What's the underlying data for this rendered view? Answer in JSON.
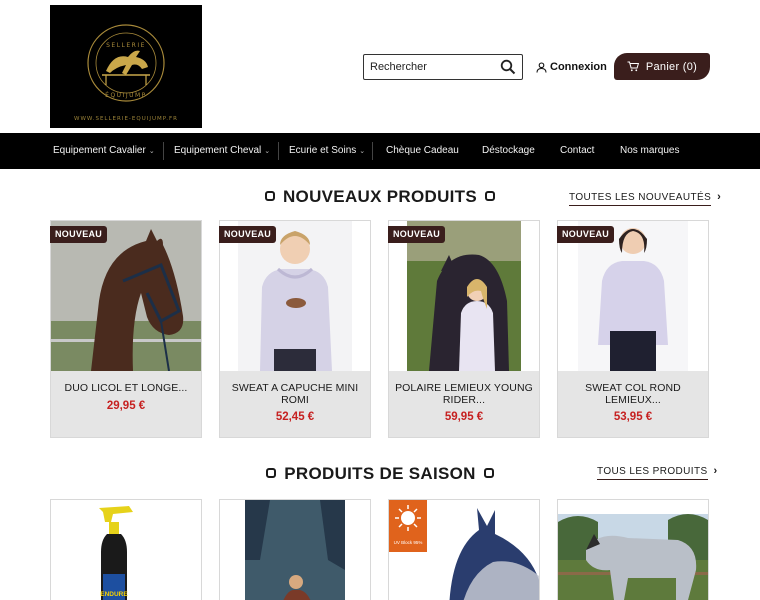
{
  "header": {
    "logo_text_top": "SELLERIE",
    "logo_text_bottom": "ÉQUIJUMP",
    "logo_url": "WWW.SELLERIE-EQUIJUMP.FR",
    "search_placeholder": "Rechercher",
    "login_label": "Connexion",
    "cart_label": "Panier (0)"
  },
  "nav": {
    "items": [
      {
        "label": "Equipement Cavalier",
        "has_dropdown": true
      },
      {
        "label": "Equipement Cheval",
        "has_dropdown": true
      },
      {
        "label": "Ecurie et Soins",
        "has_dropdown": true
      },
      {
        "label": "Chèque Cadeau",
        "has_dropdown": false
      },
      {
        "label": "Déstockage",
        "has_dropdown": false
      },
      {
        "label": "Contact",
        "has_dropdown": false
      },
      {
        "label": "Nos marques",
        "has_dropdown": false
      }
    ]
  },
  "new_products": {
    "title": "NOUVEAUX PRODUITS",
    "see_all": "TOUTES LES NOUVEAUTÉS",
    "badge": "NOUVEAU",
    "items": [
      {
        "name": "DUO LICOL ET LONGE...",
        "price": "29,95 €"
      },
      {
        "name": "SWEAT A CAPUCHE MINI ROMI",
        "price": "52,45 €"
      },
      {
        "name": "POLAIRE LEMIEUX YOUNG RIDER...",
        "price": "59,95 €"
      },
      {
        "name": "SWEAT COL ROND LEMIEUX...",
        "price": "53,95 €"
      }
    ]
  },
  "season_products": {
    "title": "PRODUITS DE SAISON",
    "see_all": "TOUS LES PRODUITS",
    "spray_label": "ENDURE",
    "uv_label": "UV Block 95%"
  },
  "colors": {
    "brand": "#3a1e1c",
    "price": "#c62020",
    "nav_bg": "#000000",
    "card_bg": "#e5e5e5"
  },
  "icons": {
    "search": "search-icon",
    "user": "user-icon",
    "cart": "cart-icon",
    "chevron": "chevron-right-icon"
  }
}
